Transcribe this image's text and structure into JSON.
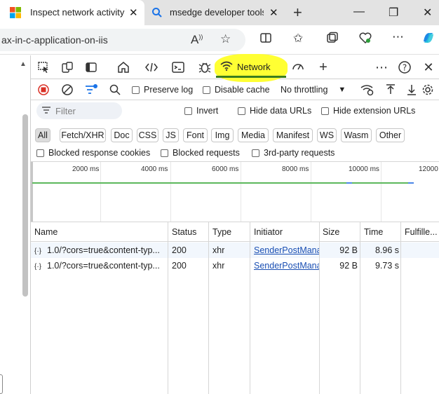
{
  "browser": {
    "tabs": [
      {
        "title": "Inspect network activity",
        "icon": "microsoft-logo-icon",
        "active": true
      },
      {
        "title": "msedge developer tools",
        "icon": "search-icon",
        "active": false
      }
    ],
    "address": "ax-in-c-application-on-iis"
  },
  "devtools": {
    "active_tab": "Network",
    "active_tab_highlight_color": "#ffff33"
  },
  "network": {
    "preserve_log": "Preserve log",
    "disable_cache": "Disable cache",
    "throttling": "No throttling",
    "filter_placeholder": "Filter",
    "invert": "Invert",
    "hide_data_urls": "Hide data URLs",
    "hide_extension_urls": "Hide extension URLs",
    "type_filters": [
      "All",
      "Fetch/XHR",
      "Doc",
      "CSS",
      "JS",
      "Font",
      "Img",
      "Media",
      "Manifest",
      "WS",
      "Wasm",
      "Other"
    ],
    "blocked_response_cookies": "Blocked response cookies",
    "blocked_requests": "Blocked requests",
    "third_party_requests": "3rd-party requests",
    "overview_ticks": [
      "2000 ms",
      "4000 ms",
      "6000 ms",
      "8000 ms",
      "10000 ms",
      "12000"
    ],
    "columns": [
      "Name",
      "Status",
      "Type",
      "Initiator",
      "Size",
      "Time",
      "Fulfille..."
    ],
    "rows": [
      {
        "name": "1.0/?cors=true&content-typ...",
        "status": "200",
        "type": "xhr",
        "initiator": "SenderPostMana",
        "size": "92 B",
        "time": "8.96 s"
      },
      {
        "name": "1.0/?cors=true&content-typ...",
        "status": "200",
        "type": "xhr",
        "initiator": "SenderPostMana",
        "size": "92 B",
        "time": "9.73 s"
      }
    ]
  }
}
